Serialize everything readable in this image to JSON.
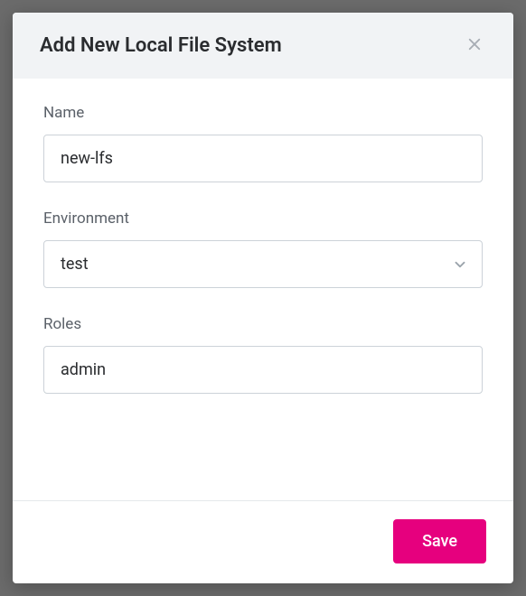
{
  "modal": {
    "title": "Add New Local File System",
    "fields": {
      "name": {
        "label": "Name",
        "value": "new-lfs"
      },
      "environment": {
        "label": "Environment",
        "value": "test"
      },
      "roles": {
        "label": "Roles",
        "value": "admin"
      }
    },
    "footer": {
      "save_label": "Save"
    }
  }
}
